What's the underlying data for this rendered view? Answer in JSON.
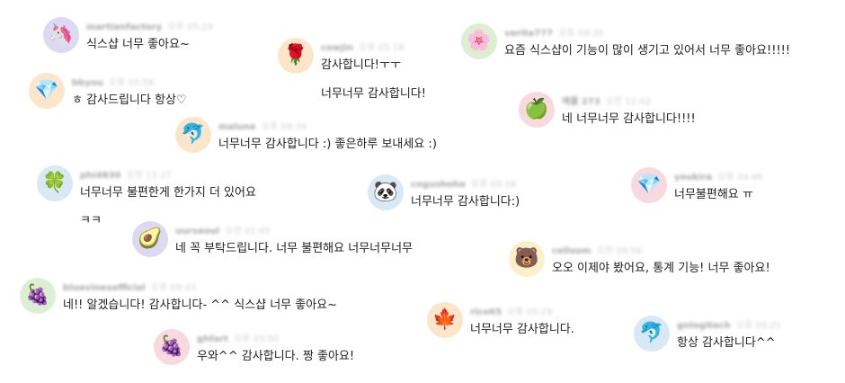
{
  "comments": [
    {
      "user": "martianfactory",
      "time": "오후 05:19",
      "avatar_icon": "unicorn-icon",
      "avatar_glyph": "🦄",
      "avatar_bg": "#dcd9f3",
      "text": "식스샵 너무 좋아요~"
    },
    {
      "user": "cowjin",
      "time": "오후 05:18",
      "avatar_icon": "rose-icon",
      "avatar_glyph": "🌹",
      "avatar_bg": "#fbe6c9",
      "text": "감사합니다!ㅜㅜ",
      "extra": "너무너무 감사합니다!"
    },
    {
      "user": "verita777",
      "time": "오후 09:35",
      "avatar_icon": "cherry-blossom-icon",
      "avatar_glyph": "🌸",
      "avatar_bg": "#dcefd3",
      "text": "요즘 식스샵이 기능이 많이 생기고 있어서 너무 좋아요!!!!!"
    },
    {
      "user": "bbyou",
      "time": "오후 05:59",
      "avatar_icon": "gem-icon",
      "avatar_glyph": "💎",
      "avatar_bg": "#fbe6c9",
      "text": "ㅎ 감사드립니다 항상♡"
    },
    {
      "user": "예플 273",
      "time": "오전 12:02",
      "avatar_icon": "apple-icon",
      "avatar_glyph": "🍏",
      "avatar_bg": "#f8d9dd",
      "text": "네 너무너무 감사합니다!!!!"
    },
    {
      "user": "malune",
      "time": "오후 09:39",
      "avatar_icon": "dolphin-icon",
      "avatar_glyph": "🐬",
      "avatar_bg": "#fbe6c9",
      "text": "너무너무 감사합니다 :) 좋은하루 보내세요 :)"
    },
    {
      "user": "phi4830",
      "time": "오전 11:27",
      "avatar_icon": "clover-icon",
      "avatar_glyph": "🍀",
      "avatar_bg": "#d8e9f5",
      "text": "너무너무 불편한게 한가지 더 있어요",
      "extra": "ㅋㅋ"
    },
    {
      "user": "cogushoho",
      "time": "오후 05:18",
      "avatar_icon": "panda-icon",
      "avatar_glyph": "🐼",
      "avatar_bg": "#d8e9f5",
      "text": "너무너무 감사합니다:)"
    },
    {
      "user": "youkira",
      "time": "오후 04:46",
      "avatar_icon": "gem-icon",
      "avatar_glyph": "💎",
      "avatar_bg": "#f8d9dd",
      "text": "너무불편해요 ㅠ"
    },
    {
      "user": "uurseoul",
      "time": "오전 01:45",
      "avatar_icon": "avocado-icon",
      "avatar_glyph": "🥑",
      "avatar_bg": "#dcd9f3",
      "text": "네 꼭 부탁드립니다. 너무 불편해요 너무너무너무"
    },
    {
      "user": "celloom",
      "time": "오전 09:56",
      "avatar_icon": "bear-icon",
      "avatar_glyph": "🐻",
      "avatar_bg": "#fbf0c9",
      "text": "오오 이제야 봤어요, 통계 기능! 너무 좋아요!"
    },
    {
      "user": "bluevinesofficial",
      "time": "오후 09:43",
      "avatar_icon": "grapes-icon",
      "avatar_glyph": "🍇",
      "avatar_bg": "#dcefd3",
      "text": "네!! 알겠습니다! 감사합니다- ^^ 식스샵 너무 좋아요~"
    },
    {
      "user": "rico65",
      "time": "오후 05:29",
      "avatar_icon": "maple-leaf-icon",
      "avatar_glyph": "🍁",
      "avatar_bg": "#fbe6c9",
      "text": "너무너무 감사합니다."
    },
    {
      "user": "gnlogitech",
      "time": "오후 05:21",
      "avatar_icon": "dolphin-icon",
      "avatar_glyph": "🐬",
      "avatar_bg": "#d8e9f5",
      "text": "항상 감사합니다^^"
    },
    {
      "user": "ghfart",
      "time": "오후 03:50",
      "avatar_icon": "grapes-icon",
      "avatar_glyph": "🍇",
      "avatar_bg": "#f8d9dd",
      "text": "우와^^ 감사합니다. 짱 좋아요!"
    }
  ]
}
